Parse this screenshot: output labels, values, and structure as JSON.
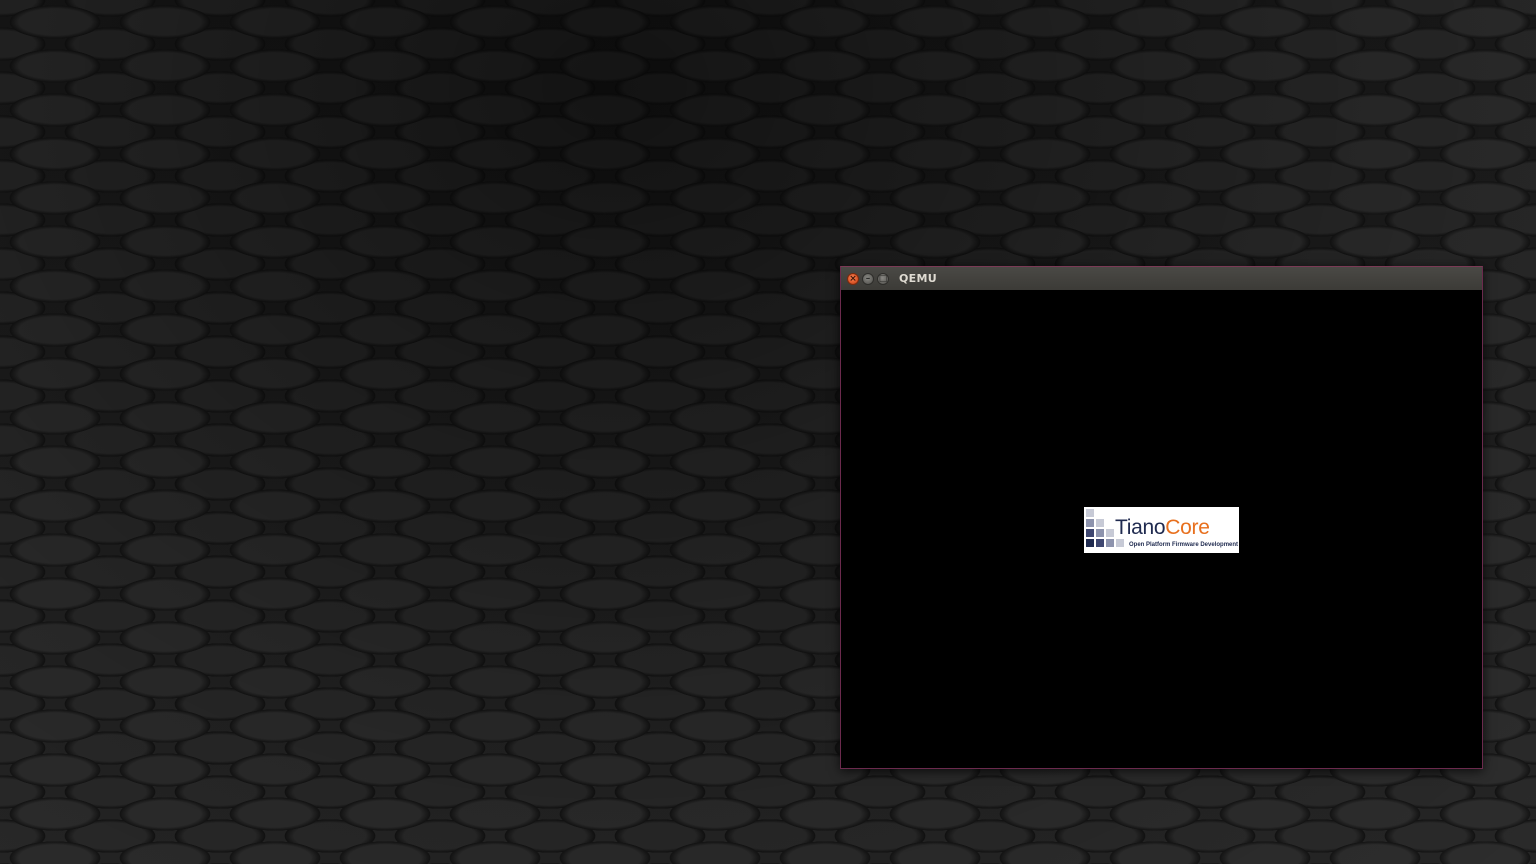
{
  "window": {
    "title": "QEMU",
    "close_glyph": "×",
    "minimize_glyph": "–",
    "maximize_glyph": "□"
  },
  "logo": {
    "name_part1": "Tiano",
    "name_part2": "Core",
    "tagline": "Open Platform Firmware Development"
  },
  "colors": {
    "close_button": "#e05a2c",
    "titlebar": "#3c3b37",
    "logo_navy": "#1f2a4f",
    "logo_orange": "#e8701e",
    "vm_screen": "#000000"
  },
  "icons": {
    "close": "close-icon",
    "minimize": "minimize-icon",
    "maximize": "maximize-icon"
  }
}
